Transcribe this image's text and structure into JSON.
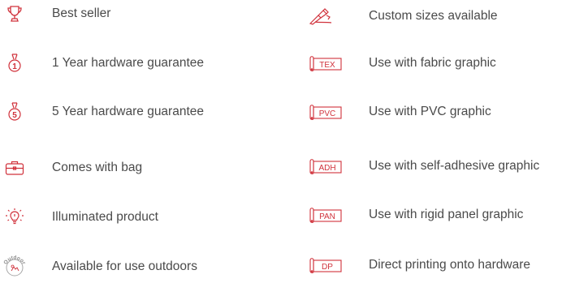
{
  "accent_color": "#d0313b",
  "left_features": [
    {
      "icon": "trophy-icon",
      "label": "Best seller"
    },
    {
      "icon": "medal-1-icon",
      "medal_number": "1",
      "label": "1 Year hardware guarantee"
    },
    {
      "icon": "medal-5-icon",
      "medal_number": "5",
      "label": "5 Year hardware guarantee"
    },
    {
      "icon": "briefcase-icon",
      "label": "Comes with bag"
    },
    {
      "icon": "lightbulb-icon",
      "label": "Illuminated product"
    },
    {
      "icon": "outdoor-badge-icon",
      "badge_text": "Outdoor",
      "label": "Available for use outdoors"
    }
  ],
  "right_features": [
    {
      "icon": "hand-writing-icon",
      "label": "Custom sizes available"
    },
    {
      "icon": "graphic-roll-icon",
      "tag": "TEX",
      "label": "Use with fabric graphic"
    },
    {
      "icon": "graphic-roll-icon",
      "tag": "PVC",
      "label": "Use with PVC graphic"
    },
    {
      "icon": "graphic-roll-icon",
      "tag": "ADH",
      "label": "Use with self-adhesive graphic"
    },
    {
      "icon": "graphic-roll-icon",
      "tag": "PAN",
      "label": "Use with rigid panel graphic"
    },
    {
      "icon": "graphic-roll-icon",
      "tag": "DP",
      "label": "Direct printing onto hardware"
    }
  ]
}
